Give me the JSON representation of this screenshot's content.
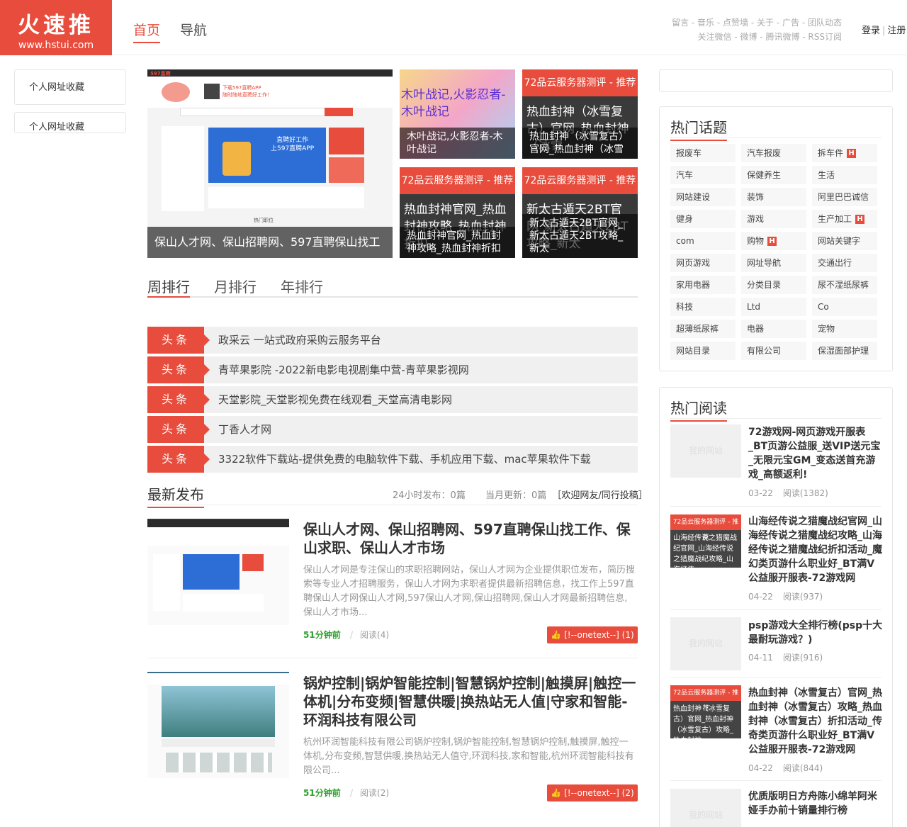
{
  "header": {
    "logo_cn": "火速推",
    "logo_url": "www.hstui.com",
    "nav": [
      "首页",
      "导航"
    ],
    "toplinks_row1": [
      "留言",
      "音乐",
      "点赞墙",
      "关于",
      "广告",
      "团队动态"
    ],
    "toplinks_row2": [
      "关注微信",
      "微博",
      "腾讯微博",
      "RSS订阅"
    ],
    "sep": " - ",
    "login": "登录",
    "register": "注册",
    "auth_sep": "|"
  },
  "left": {
    "box1": "个人网址收藏",
    "box2": "个人网址收藏"
  },
  "hero": {
    "main_caption": "保山人才网、保山招聘网、597直聘保山找工",
    "main_brand": "597直聘",
    "main_banner_line1": "下载597直聘APP",
    "main_banner_line2": "随时随地直聘好工作！",
    "main_promo_line1": "直聘好工作",
    "main_promo_line2": "上597直聘APP",
    "main_footer": "热门职位",
    "tile2_text": "木叶战记,火影忍者-木叶战记",
    "tile2_caption": "木叶战记,火影忍者-木叶战记",
    "tile3_bar": "72品云服务器测评 - 推荐",
    "tile3_text": "热血封神（冰雪复古）官网_热血封神（冰雪",
    "tile3_caption": "热血封神（冰雪复古）官网_热血封神（冰雪",
    "tile4_bar": "72品云服务器测评 - 推荐",
    "tile4_text": "热血封神官网_热血封神攻略_热血封神折扣",
    "tile4_caption": "热血封神官网_热血封神攻略_热血封神折扣",
    "tile5_bar": "72品云服务器测评 - 推荐",
    "tile5_text": "新太古遁天2BT官网_新太古遁天2BT攻略_新太",
    "tile5_caption": "新太古遁天2BT官网_新太古遁天2BT攻略_新太"
  },
  "tabs": [
    "周排行",
    "月排行",
    "年排行"
  ],
  "headlines": {
    "badge": "头条",
    "items": [
      "政采云 一站式政府采购云服务平台",
      "青苹果影院 -2022新电影电视剧集中营-青苹果影视网",
      "天堂影院_天堂影视免费在线观看_天堂高清电影网",
      "丁香人才网",
      "3322软件下载站-提供免费的电脑软件下载、手机应用下载、mac苹果软件下载"
    ]
  },
  "latest": {
    "title": "最新发布",
    "stat_24h_label": "24小时发布：",
    "stat_24h_value": "0篇",
    "stat_month_label": "当月更新：",
    "stat_month_value": "0篇",
    "submit_link": "［欢迎网友/同行投稿］",
    "articles": [
      {
        "title": "保山人才网、保山招聘网、597直聘保山找工作、保山求职、保山人才市场",
        "desc": "保山人才网是专注保山的求职招聘网站，保山人才网为企业提供职位发布，简历搜索等专业人才招聘服务，保山人才网为求职者提供最新招聘信息，找工作上597直聘保山人才网保山人才网,597保山人才网,保山招聘网,保山人才网最新招聘信息,保山人才市场...",
        "time": "51分钟前",
        "read": "阅读(4)",
        "like": "[!--onetext--] (1)"
      },
      {
        "title": "锅炉控制|锅炉智能控制|智慧锅炉控制|触摸屏|触控一体机|分布变频|智慧供暖|换热站无人值|守家和智能-环润科技有限公司",
        "desc": "杭州环润智能科技有限公司锅炉控制,锅炉智能控制,智慧锅炉控制,触摸屏,触控一体机,分布变频,智慧供暖,换热站无人值守,环润科技,家和智能,杭州环润智能科技有限公司...",
        "time": "51分钟前",
        "read": "阅读(2)",
        "like": "[!--onetext--] (2)"
      }
    ],
    "sep": "/"
  },
  "hot_topics": {
    "title": "热门话题",
    "tags": [
      {
        "t": "报废车",
        "h": false
      },
      {
        "t": "汽车报废",
        "h": false
      },
      {
        "t": "拆车件",
        "h": true
      },
      {
        "t": "汽车",
        "h": false
      },
      {
        "t": "保健养生",
        "h": false
      },
      {
        "t": "生活",
        "h": false
      },
      {
        "t": "网站建设",
        "h": false
      },
      {
        "t": "装饰",
        "h": false
      },
      {
        "t": "阿里巴巴诚信",
        "h": false
      },
      {
        "t": "健身",
        "h": false
      },
      {
        "t": "游戏",
        "h": false
      },
      {
        "t": "生产加工",
        "h": true
      },
      {
        "t": "com",
        "h": false
      },
      {
        "t": "购物",
        "h": true
      },
      {
        "t": "网站关键字",
        "h": false
      },
      {
        "t": "网页游戏",
        "h": false
      },
      {
        "t": "网址导航",
        "h": false
      },
      {
        "t": "交通出行",
        "h": false
      },
      {
        "t": "家用电器",
        "h": false
      },
      {
        "t": "分类目录",
        "h": false
      },
      {
        "t": "尿不湿纸尿裤",
        "h": false
      },
      {
        "t": "科技",
        "h": false
      },
      {
        "t": "Ltd",
        "h": false
      },
      {
        "t": "Co",
        "h": false
      },
      {
        "t": "超薄纸尿裤",
        "h": false
      },
      {
        "t": "电器",
        "h": false
      },
      {
        "t": "宠物",
        "h": false
      },
      {
        "t": "网站目录",
        "h": false
      },
      {
        "t": "有限公司",
        "h": false
      },
      {
        "t": "保湿面部护理",
        "h": false
      }
    ],
    "hot_mark": "H"
  },
  "hot_reading": {
    "title": "热门阅读",
    "placeholder": "我的网站",
    "items": [
      {
        "title": "72游戏网-网页游戏开服表_BT页游公益服_送VIP送元宝_无限元宝GM_变态送首充游戏_高额返利!",
        "date": "03-22",
        "read": "阅读(1382)"
      },
      {
        "title": "山海经传说之猎魔战纪官网_山海经传说之猎魔战纪攻略_山海经传说之猎魔战纪折扣活动_魔幻类页游什么职业好_BT满V公益服开服表-72游戏网",
        "date": "04-22",
        "read": "阅读(937)",
        "thumb_bar": "72品云服务器测评 - 推荐",
        "thumb_text": "山海经传说之猎魔战纪官网_山海经传说之猎魔战纪攻略_山海经传"
      },
      {
        "title": "psp游戏大全排行榜(psp十大最耐玩游戏？)",
        "date": "04-11",
        "read": "阅读(916)"
      },
      {
        "title": "热血封神（冰雪复古）官网_热血封神（冰雪复古）攻略_热血封神（冰雪复古）折扣活动_传奇类页游什么职业好_BT满V公益服开服表-72游戏网",
        "date": "04-22",
        "read": "阅读(844)",
        "thumb_bar": "72品云服务器测评 - 推荐",
        "thumb_text": "热血封神（冰雪复古）官网_热血封神（冰雪复古）攻略_热血封神"
      },
      {
        "title": "优质版明日方舟陈小绵羊阿米娅手办前十销量排行榜",
        "date": "",
        "read": ""
      }
    ]
  },
  "colors": {
    "accent": "#e74c3c",
    "link_green": "#2ca02c"
  }
}
